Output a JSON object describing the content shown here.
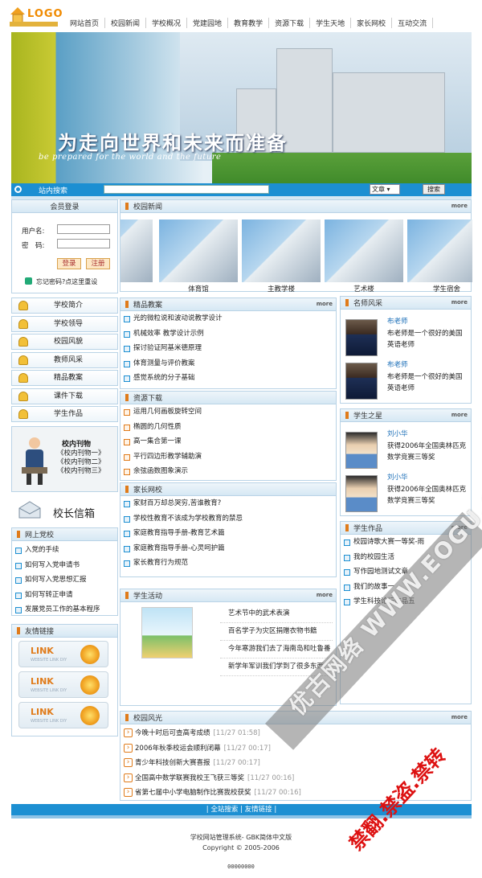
{
  "logo": {
    "text": "LOGO",
    "icon": "house-icon"
  },
  "nav": [
    "网站首页",
    "校园新闻",
    "学校概况",
    "党建园地",
    "教育教学",
    "资源下载",
    "学生天地",
    "家长网校",
    "互动交流"
  ],
  "banner": {
    "title": "为走向世界和未来而准备",
    "subtitle": "be prepared for the world and the future"
  },
  "search": {
    "label": "站内搜索",
    "select": "文章",
    "button": "搜索"
  },
  "login": {
    "title": "会员登录",
    "user_label": "用户名:",
    "pass_label": "密　码:",
    "login_btn": "登录",
    "reg_btn": "注册",
    "forgot": "忘记密码?点这里重设"
  },
  "sidenav": [
    "学校简介",
    "学校领导",
    "校园风貌",
    "教师风采",
    "精品教案",
    "课件下载",
    "学生作品"
  ],
  "journal": {
    "title": "校内刊物",
    "items": [
      "《校内刊物一》",
      "《校内刊物二》",
      "《校内刊物三》"
    ]
  },
  "principal": {
    "title": "校长信箱"
  },
  "party": {
    "title": "网上党校",
    "items": [
      "入党的手续",
      "如何写入党申请书",
      "如何写入党思想汇报",
      "如何写转正申请",
      "发展党员工作的基本程序"
    ]
  },
  "links": {
    "title": "友情链接",
    "button_text": "LINK",
    "button_sub": "WEBSITE LINK DIY"
  },
  "campus_news": {
    "title": "校园新闻",
    "more": "more",
    "photos": [
      "",
      "体育馆",
      "主教学楼",
      "艺术楼",
      "学生宿舍"
    ]
  },
  "lessons": {
    "title": "精品教案",
    "more": "more",
    "items": [
      "光的微粒说和波动说教学设计",
      "机械效率 教学设计示例",
      "探讨验证阿基米德原理",
      "体育测量与评价教案",
      "感觉系统的分子基础"
    ]
  },
  "downloads": {
    "title": "资源下载",
    "items": [
      "运用几何画板旋转空间",
      "椭圆的几何性质",
      "高一集合第一课",
      "平行四边形教学辅助演",
      "余弦函数图象演示"
    ]
  },
  "parents": {
    "title": "家长网校",
    "items": [
      "家财百万却总哭穷,苦谁教育?",
      "学校性教育不该成为学校教育的禁忌",
      "家庭教育指导手册-教育艺术篇",
      "家庭教育指导手册-心灵呵护篇",
      "家长教育行为规范"
    ]
  },
  "teachers": {
    "title": "名师风采",
    "more": "more",
    "items": [
      {
        "name": "布老师",
        "desc": "布老师是一个很好的美国英语老师"
      },
      {
        "name": "布老师",
        "desc": "布老师是一个很好的美国英语老师"
      }
    ]
  },
  "students": {
    "title": "学生之星",
    "more": "more",
    "items": [
      {
        "name": "刘小华",
        "desc": "获得2006年全国奥林匹克数学竞赛三等奖"
      },
      {
        "name": "刘小华",
        "desc": "获得2006年全国奥林匹克数学竞赛三等奖"
      }
    ]
  },
  "works": {
    "title": "学生作品",
    "more": "more",
    "items": [
      "校园诗歌大赛一等奖-雨",
      "我的校园生活",
      "写作园地测试文章",
      "我们的故事一",
      "学生科技论坛作品五"
    ]
  },
  "activities": {
    "title": "学生活动",
    "more": "more",
    "items": [
      "艺术节中的武术表演",
      "百名学子为灾区捐赠衣物书籍",
      "今年寒游我们去了海南岛和吐鲁番",
      "新学年军训我们学到了很多东西"
    ]
  },
  "scenery": {
    "title": "校园风光",
    "more": "more",
    "items": [
      {
        "t": "今晚十时后可查高考成绩",
        "d": "[11/27 01:58]"
      },
      {
        "t": "2006年秋季校运会顺利闭幕",
        "d": "[11/27 00:17]"
      },
      {
        "t": "青少年科技创新大赛喜报",
        "d": "[11/27 00:17]"
      },
      {
        "t": "全国高中数学联赛我校王飞获三等奖",
        "d": "[11/27 00:16]"
      },
      {
        "t": "省第七届中小学电脑制作比赛我校获奖",
        "d": "[11/27 00:16]"
      }
    ]
  },
  "footer": {
    "bar": "| 全站搜索 | 友情链接 |",
    "system": "学校网站管理系统- GBK简体中文版",
    "copyright": "Copyright © 2005-2006",
    "counter": "00000000"
  },
  "watermark": {
    "line1": "优古网络 WWW.EOGU.COM",
    "line2": "禁翻.禁盗.禁转"
  },
  "colors": {
    "accent": "#1c8fd2",
    "orange": "#e07b1a",
    "olive": "#a8b51f"
  }
}
